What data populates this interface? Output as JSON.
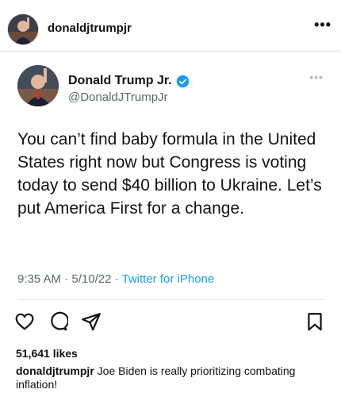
{
  "post": {
    "username": "donaldjtrumpjr",
    "more_icon": "more-horizontal-icon",
    "more_label": "•••"
  },
  "tweet": {
    "name": "Donald Trump Jr.",
    "handle": "@DonaldJTrumpJr",
    "more_label": "•••",
    "text": "You can’t find baby formula in the United States right now but Congress is voting today to send $40 billion to Ukraine. Let’s put America First for a change.",
    "time": "9:35 AM",
    "separator": " · ",
    "date": "5/10/22",
    "source": "Twitter for iPhone",
    "accent_color": "#1d9bf0"
  },
  "actions": {
    "like_icon": "heart-icon",
    "comment_icon": "comment-icon",
    "share_icon": "send-icon",
    "save_icon": "bookmark-icon"
  },
  "likes": "51,641 likes",
  "caption": {
    "username": "donaldjtrumpjr",
    "text": "Joe Biden is really prioritizing combating inflation!"
  }
}
